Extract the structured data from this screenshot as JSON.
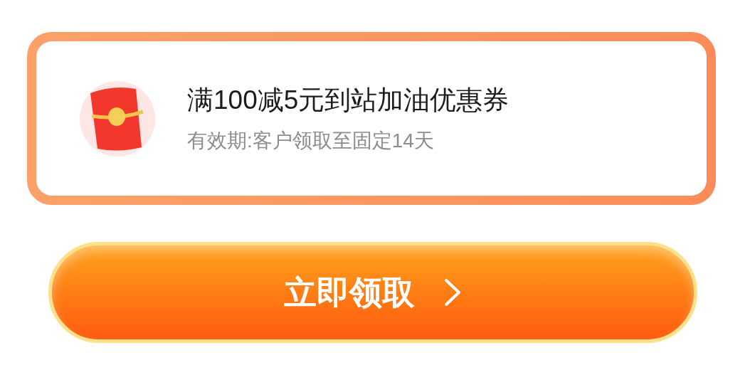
{
  "coupon": {
    "title": "满100减5元到站加油优惠券",
    "validity": "有效期:客户领取至固定14天"
  },
  "button": {
    "label": "立即领取"
  }
}
